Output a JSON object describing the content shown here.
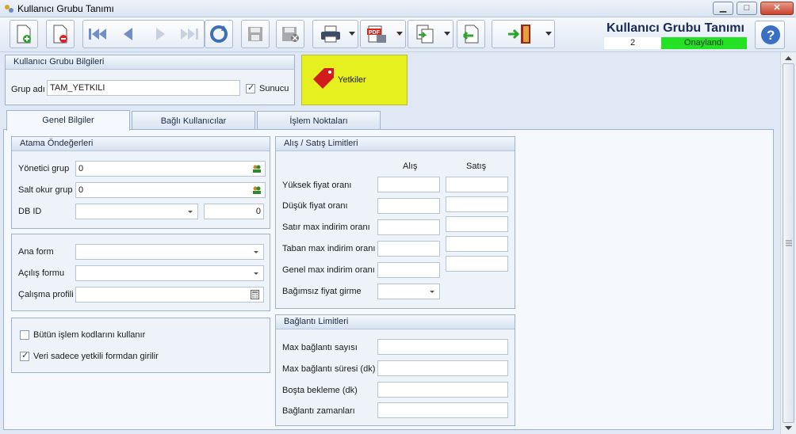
{
  "window": {
    "title": "Kullanıcı Grubu Tanımı",
    "minimize": "▁",
    "maximize": "□",
    "close": "✕"
  },
  "header": {
    "title": "Kullanıcı Grubu Tanımı",
    "number": "2",
    "status": "Onaylandı",
    "status_color": "#25e125"
  },
  "toolbar": {
    "buttons": [
      "new-document-icon",
      "delete-document-icon",
      "first-record-icon",
      "previous-record-icon",
      "next-record-icon",
      "last-record-icon",
      "refresh-icon",
      "save-icon",
      "cancel-save-icon",
      "print-icon",
      "pdf-export-icon",
      "copy-icon",
      "import-icon",
      "exit-door-icon",
      "help-icon"
    ]
  },
  "group_info": {
    "title": "Kullanıcı Grubu Bilgileri",
    "name_label": "Grup adı",
    "name_value": "TAM_YETKILI",
    "server_label": "Sunucu",
    "server_checked": true
  },
  "permissions_button": {
    "label": "Yetkiler",
    "color": "#e6f01f"
  },
  "tabs": [
    {
      "label": "Genel Bilgiler"
    },
    {
      "label": "Bağlı Kullanıcılar"
    },
    {
      "label": "İşlem Noktaları"
    }
  ],
  "defaults": {
    "title": "Atama Öndeğerleri",
    "manager_label": "Yönetici grup",
    "manager_value": "0",
    "readonly_label": "Salt okur grup",
    "readonly_value": "0",
    "db_label": "DB ID",
    "db_value": "",
    "db_number": "0"
  },
  "forms": {
    "main_label": "Ana form",
    "main_value": "",
    "opening_label": "Açılış formu",
    "opening_value": "",
    "profile_label": "Çalışma profili",
    "profile_value": ""
  },
  "options": {
    "all_codes_label": "Bütün işlem kodlarını kullanır",
    "all_codes_checked": false,
    "authorized_only_label": "Veri sadece yetkili formdan girilir",
    "authorized_only_checked": true
  },
  "limits": {
    "title": "Alış / Satış Limitleri",
    "col_buy": "Alış",
    "col_sell": "Satış",
    "rows": [
      "Yüksek fiyat oranı",
      "Düşük fiyat oranı",
      "Satır max indirim oranı",
      "Taban max indirim oranı",
      "Genel max indirim oranı"
    ],
    "independent_label": "Bağımsız fiyat girme",
    "independent_value": ""
  },
  "connection": {
    "title": "Bağlantı Limitleri",
    "rows": [
      "Max bağlantı sayısı",
      "Max bağlantı süresi (dk)",
      "Boşta bekleme (dk)",
      "Bağlantı zamanları"
    ]
  }
}
